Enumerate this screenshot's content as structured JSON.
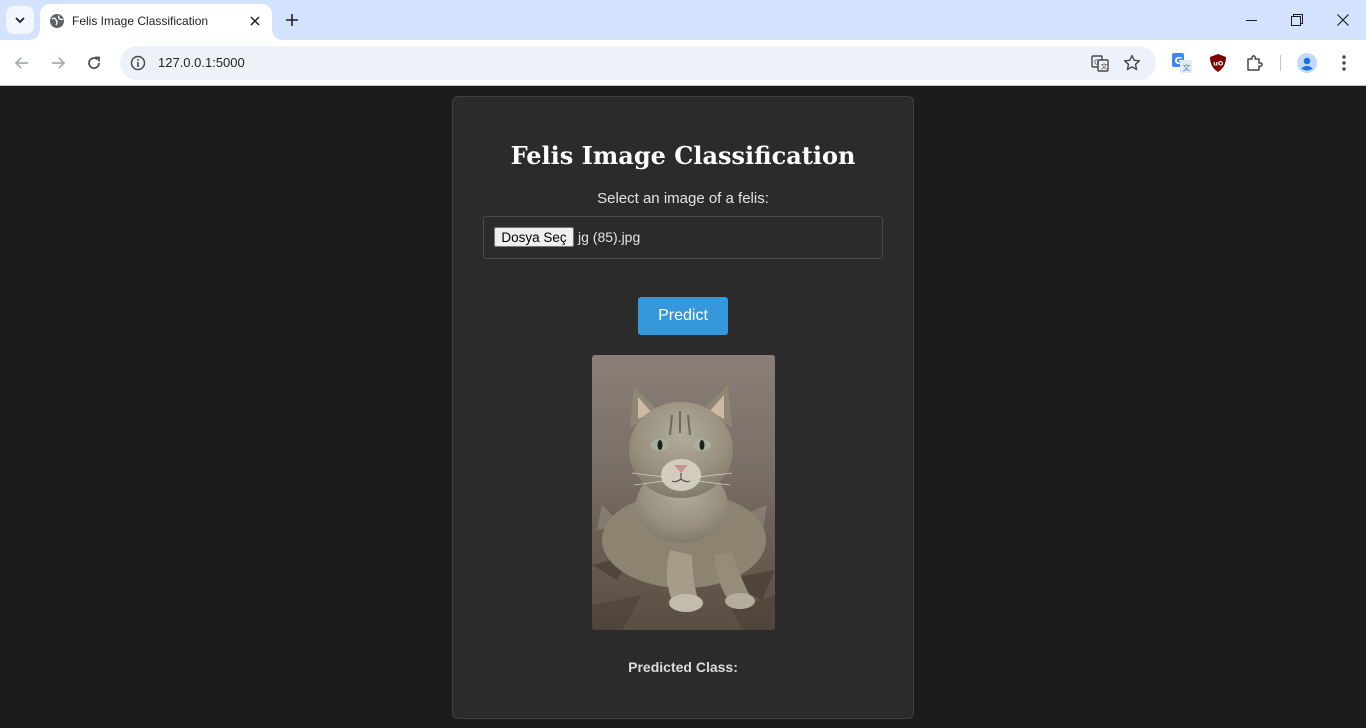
{
  "browser": {
    "tab_title": "Felis Image Classification",
    "url": "127.0.0.1:5000",
    "extensions": [
      "google-translate-icon",
      "ublock-icon",
      "extensions-puzzle-icon",
      "profile-icon"
    ]
  },
  "app": {
    "title": "Felis Image Classification",
    "select_label": "Select an image of a felis:",
    "file_button_label": "Dosya Seç",
    "file_name": "jg (85).jpg",
    "predict_label": "Predict",
    "preview_alt": "Uploaded image preview",
    "result_label": "Predicted Class:"
  },
  "colors": {
    "page_background": "#1c1c1c",
    "card_background": "#2b2b2b",
    "accent": "#3498db",
    "tabbar": "#d3e3fd"
  }
}
